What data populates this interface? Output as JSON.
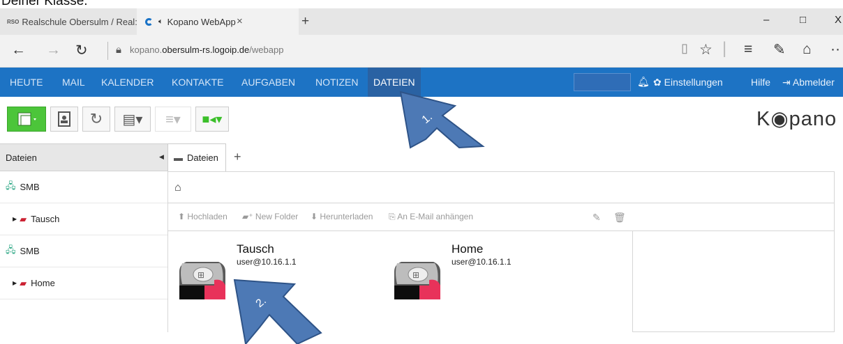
{
  "page_top_fragment": "Deiner Klasse.",
  "browser": {
    "tab1_favicon": "RSO",
    "tab1_title": "Realschule Obersulm / Real:",
    "tab2_title": "Kopano WebApp",
    "tab2_close": "×",
    "new_tab": "+",
    "minimize": "–",
    "maximize": "□",
    "close": "X",
    "address_host_prefix": "kopano.",
    "address_host": "obersulm-rs.logoip.de",
    "address_path": "/webapp",
    "more": "··"
  },
  "menu": {
    "items": [
      "HEUTE",
      "MAIL",
      "KALENDER",
      "KONTAKTE",
      "AUFGABEN",
      "NOTIZEN",
      "DATEIEN"
    ],
    "active": "DATEIEN",
    "settings": "Einstellungen",
    "help": "Hilfe",
    "logout": "Abmelder"
  },
  "logo_text": "K◉pano",
  "sidebar": {
    "header": "Dateien",
    "items": [
      {
        "label": "SMB"
      },
      {
        "label": "Tausch"
      },
      {
        "label": "SMB"
      },
      {
        "label": "Home"
      }
    ]
  },
  "panel": {
    "tab_label": "Dateien",
    "add_tab": "+",
    "actions": {
      "upload": "Hochladen",
      "new_folder": "New Folder",
      "download": "Herunterladen",
      "attach": "An E-Mail anhängen"
    },
    "files": [
      {
        "name": "Tausch",
        "user": "user@10.16.1.1"
      },
      {
        "name": "Home",
        "user": "user@10.16.1.1"
      }
    ]
  },
  "annotations": {
    "arrow1": "1.",
    "arrow2": "2."
  },
  "colors": {
    "menubar": "#1d73c4",
    "arrow_fill": "#4d79b5",
    "arrow_stroke": "#2e5387",
    "green_button": "#4cc53a"
  }
}
